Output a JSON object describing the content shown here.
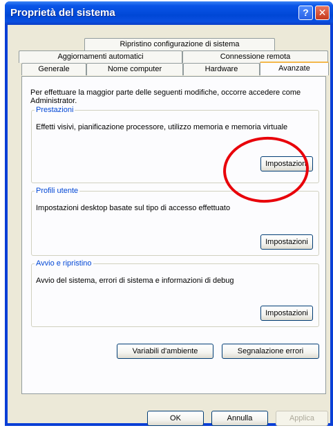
{
  "window": {
    "title": "Proprietà del sistema"
  },
  "titlebar": {
    "help": "?",
    "close": "✕"
  },
  "tabs": {
    "row1": [
      "Ripristino configurazione di sistema"
    ],
    "row2": [
      "Aggiornamenti automatici",
      "Connessione remota"
    ],
    "row3": [
      "Generale",
      "Nome computer",
      "Hardware",
      "Avanzate"
    ],
    "active": "Avanzate"
  },
  "intro": "Per effettuare la maggior parte delle seguenti modifiche, occorre accedere come Administrator.",
  "groups": [
    {
      "title": "Prestazioni",
      "description": "Effetti visivi, pianificazione processore, utilizzo memoria e memoria virtuale",
      "button": "Impostazioni"
    },
    {
      "title": "Profili utente",
      "description": "Impostazioni desktop basate sul tipo di accesso effettuato",
      "button": "Impostazioni"
    },
    {
      "title": "Avvio e ripristino",
      "description": "Avvio del sistema, errori di sistema e informazioni di debug",
      "button": "Impostazioni"
    }
  ],
  "buttons": {
    "env_vars": "Variabili d'ambiente",
    "error_report": "Segnalazione errori",
    "ok": "OK",
    "cancel": "Annulla",
    "apply": "Applica"
  },
  "colors": {
    "titlebar": "#0a55e8",
    "group_title": "#0046d5",
    "highlight": "#e8000a",
    "active_tab_accent": "#f3b84c"
  }
}
